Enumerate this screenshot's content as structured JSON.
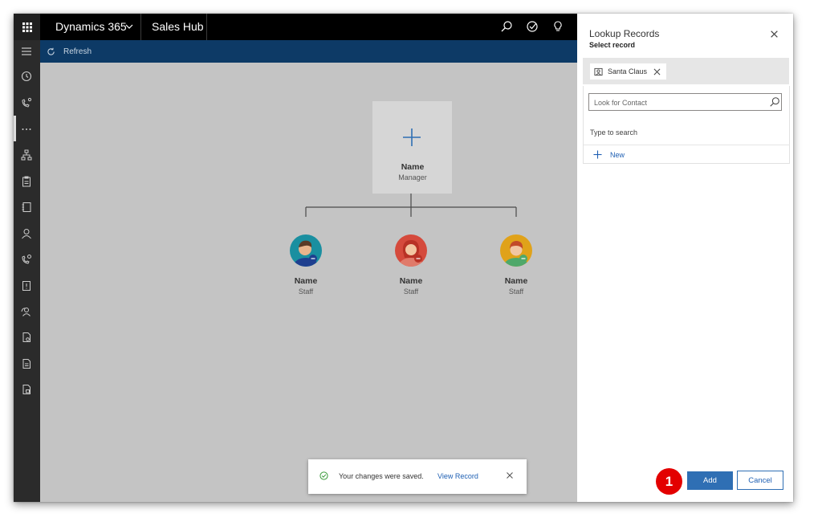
{
  "topbar": {
    "app_name": "Dynamics 365",
    "hub_name": "Sales Hub",
    "icons": [
      "waffle-icon",
      "chevron-down-icon",
      "search-icon",
      "task-icon",
      "lightbulb-icon"
    ]
  },
  "leftnav": {
    "icons": [
      "hamburger-icon",
      "recent-icon",
      "phone-person-icon",
      "more-icon",
      "org-chart-icon",
      "clipboard-icon",
      "notebook-icon",
      "person-icon",
      "contact-phone-icon",
      "alert-doc-icon",
      "people-icon",
      "settings-doc-icon",
      "document-icon",
      "edit-doc-icon"
    ]
  },
  "cmdbar": {
    "refresh_label": "Refresh"
  },
  "orgchart": {
    "manager": {
      "name": "Name",
      "role": "Manager"
    },
    "staff": [
      {
        "name": "Name",
        "role": "Staff",
        "color": "#1a8fa0"
      },
      {
        "name": "Name",
        "role": "Staff",
        "color": "#d54a3c"
      },
      {
        "name": "Name",
        "role": "Staff",
        "color": "#e0a21a"
      }
    ]
  },
  "toast": {
    "message": "Your changes were saved.",
    "link": "View Record"
  },
  "panel": {
    "title": "Lookup Records",
    "subtitle": "Select record",
    "selected_chip": "Santa Claus",
    "search_placeholder": "Look for Contact",
    "type_hint": "Type to search",
    "new_label": "New",
    "step_badge": "1",
    "add_label": "Add",
    "cancel_label": "Cancel"
  },
  "colors": {
    "topbar": "#000000",
    "cmdbar": "#0d3a66",
    "leftnav": "#2b2b2b",
    "accent": "#2f6fb4",
    "link": "#1e5fb3",
    "badge": "#e30000"
  }
}
